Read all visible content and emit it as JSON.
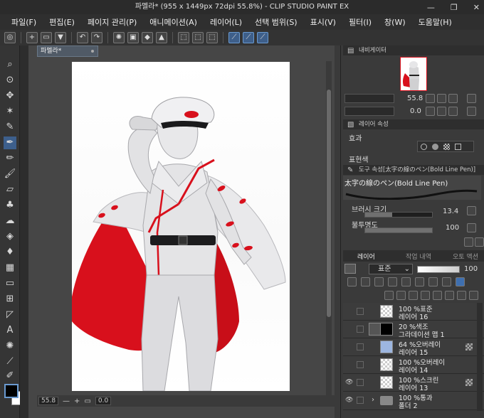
{
  "window": {
    "title": "파멜라* (955 x 1449px 72dpi 55.8%)  - CLIP STUDIO PAINT EX",
    "minimize": "—",
    "maximize": "❐",
    "close": "✕"
  },
  "menu": [
    "파일(F)",
    "편집(E)",
    "페이지 관리(P)",
    "애니메이션(A)",
    "레이어(L)",
    "선택 범위(S)",
    "표시(V)",
    "필터(I)",
    "창(W)",
    "도움말(H)"
  ],
  "document": {
    "tab_label": "파멜라*",
    "zoom": "55.8",
    "rotation": "0.0"
  },
  "navigator": {
    "title": "내비게이터",
    "zoom": "55.8",
    "rotation": "0.0"
  },
  "layer_property": {
    "title": "레이어 속성",
    "effect_label": "효과",
    "color_label": "표현색"
  },
  "tool_property": {
    "title": "도구 속성[太字の線のペン(Bold Line Pen)]",
    "brush_name": "太字の線のペン(Bold Line Pen)",
    "brush_size_label": "브러시 크기",
    "brush_size_value": "13.4",
    "opacity_label": "불투명도",
    "opacity_value": "100",
    "opacity_fraction": 1.0
  },
  "layer_panel": {
    "tabs": [
      "레이어",
      "작업 내역",
      "오토 액션"
    ],
    "blend_mode": "표준",
    "opacity": "100",
    "layers": [
      {
        "line1": "100 %표준",
        "line2": "레이어 16",
        "visible": false
      },
      {
        "line1": "20 %색조",
        "line2": "그라데이션 맵 1",
        "visible": false
      },
      {
        "line1": "64 %오버레이",
        "line2": "레이어 15",
        "visible": false
      },
      {
        "line1": "100 %오버레이",
        "line2": "레이어 14",
        "visible": false
      },
      {
        "line1": "100 %스크린",
        "line2": "레이어 13",
        "visible": true
      },
      {
        "line1": "100 %통과",
        "line2": "폴더 2",
        "visible": true
      }
    ]
  },
  "colors": {
    "accent": "#3d5f8c",
    "red": "#d8101c",
    "main_color": "#000000",
    "sub_color": "#ffffff"
  }
}
